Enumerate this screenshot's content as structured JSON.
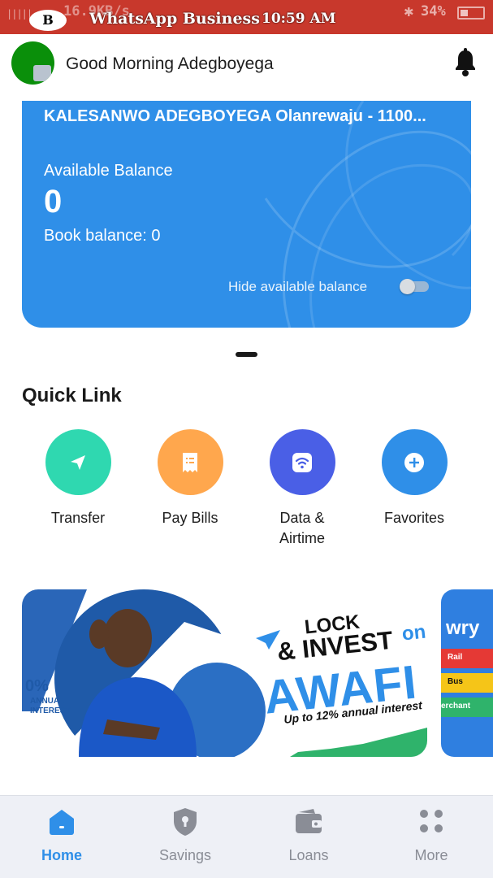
{
  "status_bar": {
    "left_fragment": "B",
    "speed": "16.9KB/s",
    "app_title": "WhatsApp Business",
    "time": "10:59 AM",
    "battery": "34%"
  },
  "header": {
    "greeting": "Good Morning Adegboyega"
  },
  "card": {
    "account_name": "KALESANWO ADEGBOYEGA Olanrewaju - 1100...",
    "available_balance_label": "Available Balance",
    "available_balance_value": "0",
    "book_balance_label": "Book balance: 0",
    "hide_balance_label": "Hide available balance",
    "hide_balance_on": false
  },
  "quick_link": {
    "title": "Quick Link",
    "items": [
      {
        "label": "Transfer",
        "icon": "send-icon",
        "color": "#2fd8b0"
      },
      {
        "label": "Pay Bills",
        "icon": "receipt-icon",
        "color": "#ffa74d"
      },
      {
        "label": "Data &\nAirtime",
        "icon": "wifi-icon",
        "color": "#4a5fe6"
      },
      {
        "label": "Favorites",
        "icon": "plus-icon",
        "color": "#2f8fe8"
      }
    ]
  },
  "banner": {
    "annual_interest_fragment": "0%",
    "annual": "ANNUAL",
    "interest": "INTEREST",
    "lock": "LOCK",
    "and_invest": "& INVEST",
    "on": "on",
    "awafi": "AWAFI",
    "tagline": "Up to 12% annual interest"
  },
  "banner2": {
    "heading": "wry",
    "rows": [
      "Rail",
      "Bus",
      "erchant"
    ]
  },
  "bottom_nav": {
    "items": [
      {
        "label": "Home",
        "icon": "home-icon",
        "active": true
      },
      {
        "label": "Savings",
        "icon": "shield-keyhole-icon",
        "active": false
      },
      {
        "label": "Loans",
        "icon": "wallet-icon",
        "active": false
      },
      {
        "label": "More",
        "icon": "grid-dots-icon",
        "active": false
      }
    ]
  },
  "colors": {
    "primary": "#2f8fe8",
    "status_bar": "#c8382c",
    "nav_background": "#eef0f6"
  }
}
